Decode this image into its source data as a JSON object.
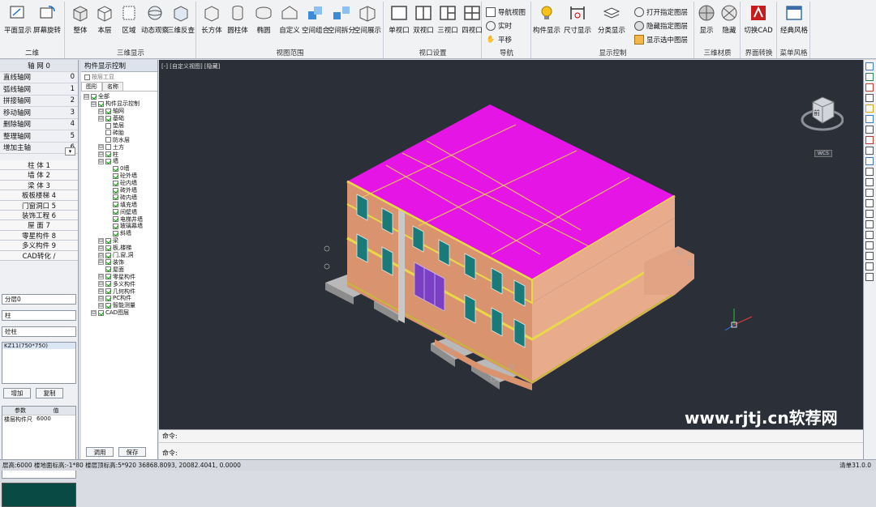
{
  "ribbon": {
    "groups": [
      {
        "label": "二维",
        "buttons": [
          "平面显示",
          "屏幕旋转"
        ]
      },
      {
        "label": "三维显示",
        "buttons": [
          "整体",
          "本层",
          "区域",
          "动态观察",
          "三维反查"
        ]
      },
      {
        "label": "视图范围",
        "buttons": [
          "长方体",
          "圆柱体",
          "椭圆",
          "自定义",
          "空间组合",
          "空间拆分",
          "空间展示"
        ]
      },
      {
        "label": "视口设置",
        "buttons": [
          "单视口",
          "双视口",
          "三视口",
          "四视口"
        ]
      },
      {
        "label": "导航",
        "items": [
          "导航视图",
          "实时",
          "平移"
        ]
      },
      {
        "label": "显示控制",
        "buttons": [
          "构件显示",
          "尺寸显示",
          "分类显示"
        ],
        "items": [
          "打开指定图层",
          "隐藏指定图层",
          "显示选中图层"
        ]
      },
      {
        "label": "三维材质",
        "buttons": [
          "显示",
          "隐藏"
        ]
      },
      {
        "label": "界面转换",
        "buttons": [
          "切换CAD"
        ]
      },
      {
        "label": "菜单风格",
        "buttons": [
          "经典风格"
        ]
      }
    ]
  },
  "axis_panel": {
    "title": "轴 网 0",
    "items": [
      {
        "label": "直线轴网",
        "key": "0"
      },
      {
        "label": "弧线轴网",
        "key": "1"
      },
      {
        "label": "拼接轴网",
        "key": "2"
      },
      {
        "label": "移动轴网",
        "key": "3"
      },
      {
        "label": "删除轴网",
        "key": "4"
      },
      {
        "label": "整理轴网",
        "key": "5"
      },
      {
        "label": "增加主轴",
        "key": "6"
      }
    ]
  },
  "categories": [
    "柱 体 1",
    "墙 体 2",
    "梁 体 3",
    "板板楼梯 4",
    "门窗洞口 5",
    "装饰工程 6",
    "屋 面 7",
    "零星构件 8",
    "多义构件 9",
    "CAD转化 /"
  ],
  "props": {
    "floor": "分层0",
    "type1": "柱",
    "type2": "砼柱",
    "component": "KZ11(750*750)",
    "btn_add": "增加",
    "btn_copy": "复制",
    "col_param": "参数",
    "col_value": "值",
    "row1_name": "楼层",
    "row1_sub": "构件尺",
    "row1_value": "6000"
  },
  "tree": {
    "title": "构件显示控制",
    "checkbox_label": "按层工显",
    "tab1": "图形",
    "tab2": "名称",
    "nodes": [
      {
        "label": "全部",
        "lvl": 0,
        "on": true,
        "exp": true
      },
      {
        "label": "构件显示控制",
        "lvl": 1,
        "on": true,
        "exp": true
      },
      {
        "label": "轴网",
        "lvl": 2,
        "on": true,
        "exp": true
      },
      {
        "label": "基础",
        "lvl": 2,
        "on": true,
        "exp": true
      },
      {
        "label": "垫层",
        "lvl": 2,
        "on": false
      },
      {
        "label": "砖胎",
        "lvl": 2,
        "on": false
      },
      {
        "label": "防水层",
        "lvl": 2,
        "on": false
      },
      {
        "label": "土方",
        "lvl": 2,
        "on": false,
        "exp": true
      },
      {
        "label": "柱",
        "lvl": 2,
        "on": true,
        "exp": true
      },
      {
        "label": "墙",
        "lvl": 2,
        "on": true,
        "exp": true
      },
      {
        "label": "0墙",
        "lvl": 3,
        "on": true
      },
      {
        "label": "砼外墙",
        "lvl": 3,
        "on": true
      },
      {
        "label": "砼内墙",
        "lvl": 3,
        "on": true
      },
      {
        "label": "砖外墙",
        "lvl": 3,
        "on": true
      },
      {
        "label": "砖内墙",
        "lvl": 3,
        "on": true
      },
      {
        "label": "填充墙",
        "lvl": 3,
        "on": true
      },
      {
        "label": "间壁墙",
        "lvl": 3,
        "on": true
      },
      {
        "label": "电梯井墙",
        "lvl": 3,
        "on": true
      },
      {
        "label": "玻璃幕墙",
        "lvl": 3,
        "on": true
      },
      {
        "label": "斜墙",
        "lvl": 3,
        "on": true
      },
      {
        "label": "梁",
        "lvl": 2,
        "on": true,
        "exp": true
      },
      {
        "label": "板,楼梯",
        "lvl": 2,
        "on": true,
        "exp": true
      },
      {
        "label": "门,窗,洞",
        "lvl": 2,
        "on": true,
        "exp": true
      },
      {
        "label": "装饰",
        "lvl": 2,
        "on": true,
        "exp": true
      },
      {
        "label": "屋面",
        "lvl": 2,
        "on": true
      },
      {
        "label": "零星构件",
        "lvl": 2,
        "on": true,
        "exp": true
      },
      {
        "label": "多义构件",
        "lvl": 2,
        "on": true,
        "exp": true
      },
      {
        "label": "几何构件",
        "lvl": 2,
        "on": true,
        "exp": true
      },
      {
        "label": "PC构件",
        "lvl": 2,
        "on": true,
        "exp": true
      },
      {
        "label": "智能测量",
        "lvl": 2,
        "on": true,
        "exp": true
      },
      {
        "label": "CAD图层",
        "lvl": 1,
        "on": true,
        "exp": true
      }
    ],
    "btn_apply": "调用",
    "btn_save": "保存"
  },
  "viewport": {
    "label": "[-] [自定义视图] [隐藏]",
    "cube_label": "前",
    "wcs": "WCS"
  },
  "command": {
    "line1": "命令:",
    "line2": "命令:"
  },
  "status": {
    "text": "层高:6000  楼地面标高:-1*80  楼层顶标高:5*920  36868.8093, 20082.4041, 0.0000",
    "right": "清单31.0.0"
  },
  "watermark": "www.rjtj.cn软荐网",
  "colors": {
    "roof": "#e515e6",
    "wall": "#e3a588",
    "beam": "#e8d84a",
    "window": "#1a7a7a",
    "bg": "#2a2f38"
  }
}
